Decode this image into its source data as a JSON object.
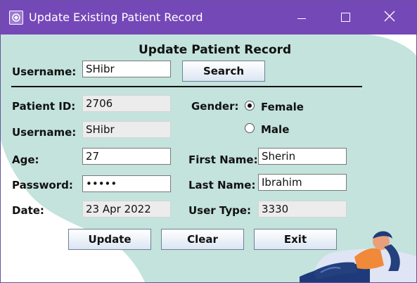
{
  "window": {
    "title": "Update Existing Patient Record",
    "icons": {
      "app": "app-icon",
      "minimize": "minimize-icon",
      "maximize": "maximize-icon",
      "close": "close-icon"
    }
  },
  "form": {
    "heading": "Update Patient Record",
    "search": {
      "label": "Username:",
      "value": "SHibr",
      "button_label": "Search"
    },
    "patient_id": {
      "label": "Patient ID:",
      "value": "2706"
    },
    "username": {
      "label": "Username:",
      "value": "SHibr"
    },
    "age": {
      "label": "Age:",
      "value": "27"
    },
    "password": {
      "label": "Password:",
      "value": "•••••"
    },
    "date": {
      "label": "Date:",
      "value": "23 Apr 2022"
    },
    "gender": {
      "label": "Gender:",
      "options": [
        "Female",
        "Male"
      ],
      "selected": "Female"
    },
    "first_name": {
      "label": "First Name:",
      "value": "Sherin"
    },
    "last_name": {
      "label": "Last Name:",
      "value": "Ibrahim"
    },
    "user_type": {
      "label": "User Type:",
      "value": "3330"
    },
    "buttons": {
      "update": "Update",
      "clear": "Clear",
      "exit": "Exit"
    }
  },
  "colors": {
    "titlebar": "#7548b8",
    "background_shape": "#c3e3dc",
    "button_gradient_end": "#dbe6f3"
  }
}
